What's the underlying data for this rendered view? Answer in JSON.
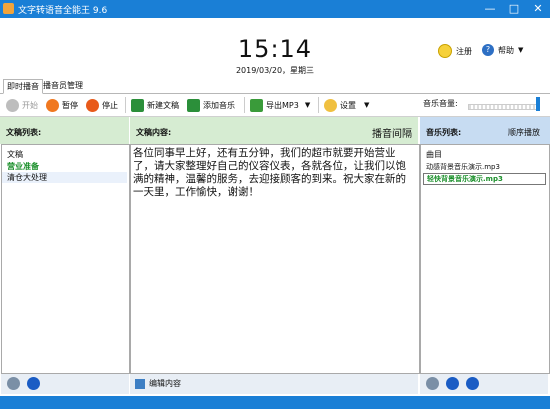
{
  "window": {
    "title": "文字转语音全能王 9.6"
  },
  "header": {
    "time": "15:14",
    "date": "2019/03/20，星期三",
    "register_label": "注册",
    "help_label": "帮助"
  },
  "tabs": [
    {
      "label": "即时播音"
    },
    {
      "label": "播音员管理"
    }
  ],
  "toolbar": {
    "start_label": "开始",
    "pause_label": "暂停",
    "stop_label": "停止",
    "new_doc_label": "新建文稿",
    "add_music_label": "添加音乐",
    "export_label": "导出MP3",
    "settings_label": "设置",
    "music_volume_label": "音乐音量:"
  },
  "music_volume": 0.97,
  "columns": {
    "doc_list_title": "文稿列表:",
    "content_title": "文稿内容:",
    "interval_label": "播音间隔",
    "music_list_title": "音乐列表:",
    "play_mode_label": "顺序播放"
  },
  "doc_list": {
    "header": "文稿",
    "items": [
      "营业准备",
      "清仓大处理"
    ]
  },
  "content_text": "各位同事早上好，还有五分钟，我们的超市就要开始营业了，请大家整理好自己的仪容仪表，各就各位，让我们以饱满的精神，温馨的服务，去迎接顾客的到来。祝大家在新的一天里，工作愉快，谢谢！",
  "music_list": {
    "header": "曲目",
    "items": [
      "动感背景音乐演示.mp3",
      "轻快背景音乐演示.mp3"
    ]
  },
  "bottom": {
    "edit_label": "编辑内容"
  },
  "colors": {
    "accent": "#1a7fd6",
    "green_header": "#d6ecd2",
    "blue_header": "#c7dcf2"
  }
}
